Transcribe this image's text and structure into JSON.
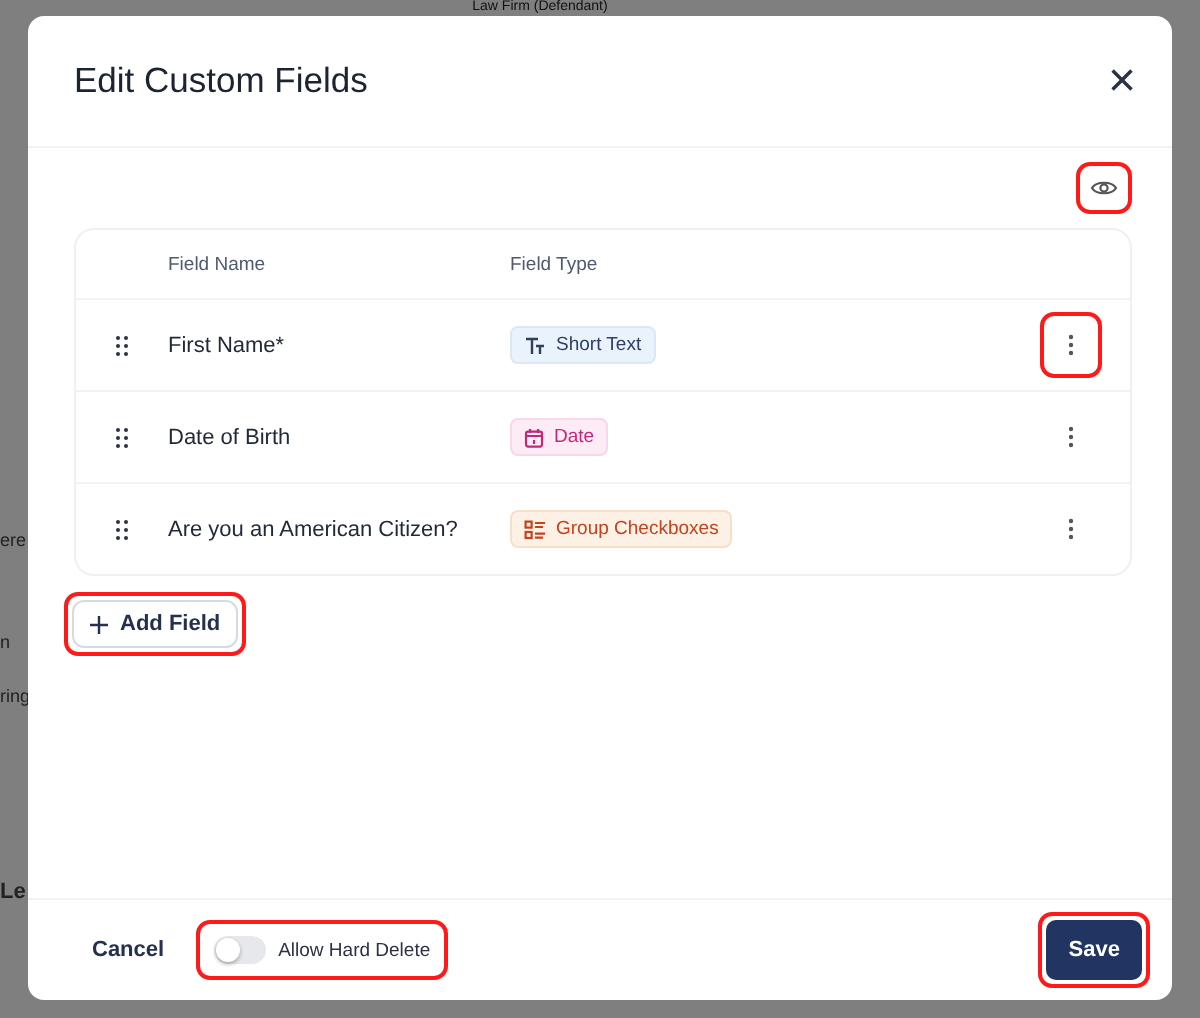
{
  "backdrop": {
    "heading": "Law Firm (Defendant)",
    "fragments": [
      {
        "text": "ere",
        "bold": false
      },
      {
        "text": "n",
        "bold": false
      },
      {
        "text": "ring",
        "bold": false
      },
      {
        "text": "Le",
        "bold": true
      }
    ]
  },
  "dialog": {
    "title": "Edit Custom Fields",
    "close": "×"
  },
  "preview_highlighted": true,
  "table": {
    "columns": [
      "Field Name",
      "Field Type"
    ],
    "rows": [
      {
        "name": "First Name*",
        "type": "Short Text",
        "kind": "text",
        "menu_highlighted": true
      },
      {
        "name": "Date of Birth",
        "type": "Date",
        "kind": "date",
        "menu_highlighted": false
      },
      {
        "name": "Are you an American Citizen?",
        "type": "Group Checkboxes",
        "kind": "checkboxes",
        "menu_highlighted": false
      }
    ]
  },
  "add_field": {
    "label": "Add Field",
    "highlighted": true
  },
  "footer": {
    "cancel": "Cancel",
    "toggle": {
      "label": "Allow Hard Delete",
      "on": false,
      "highlighted": true
    },
    "save": {
      "label": "Save",
      "highlighted": true
    }
  }
}
